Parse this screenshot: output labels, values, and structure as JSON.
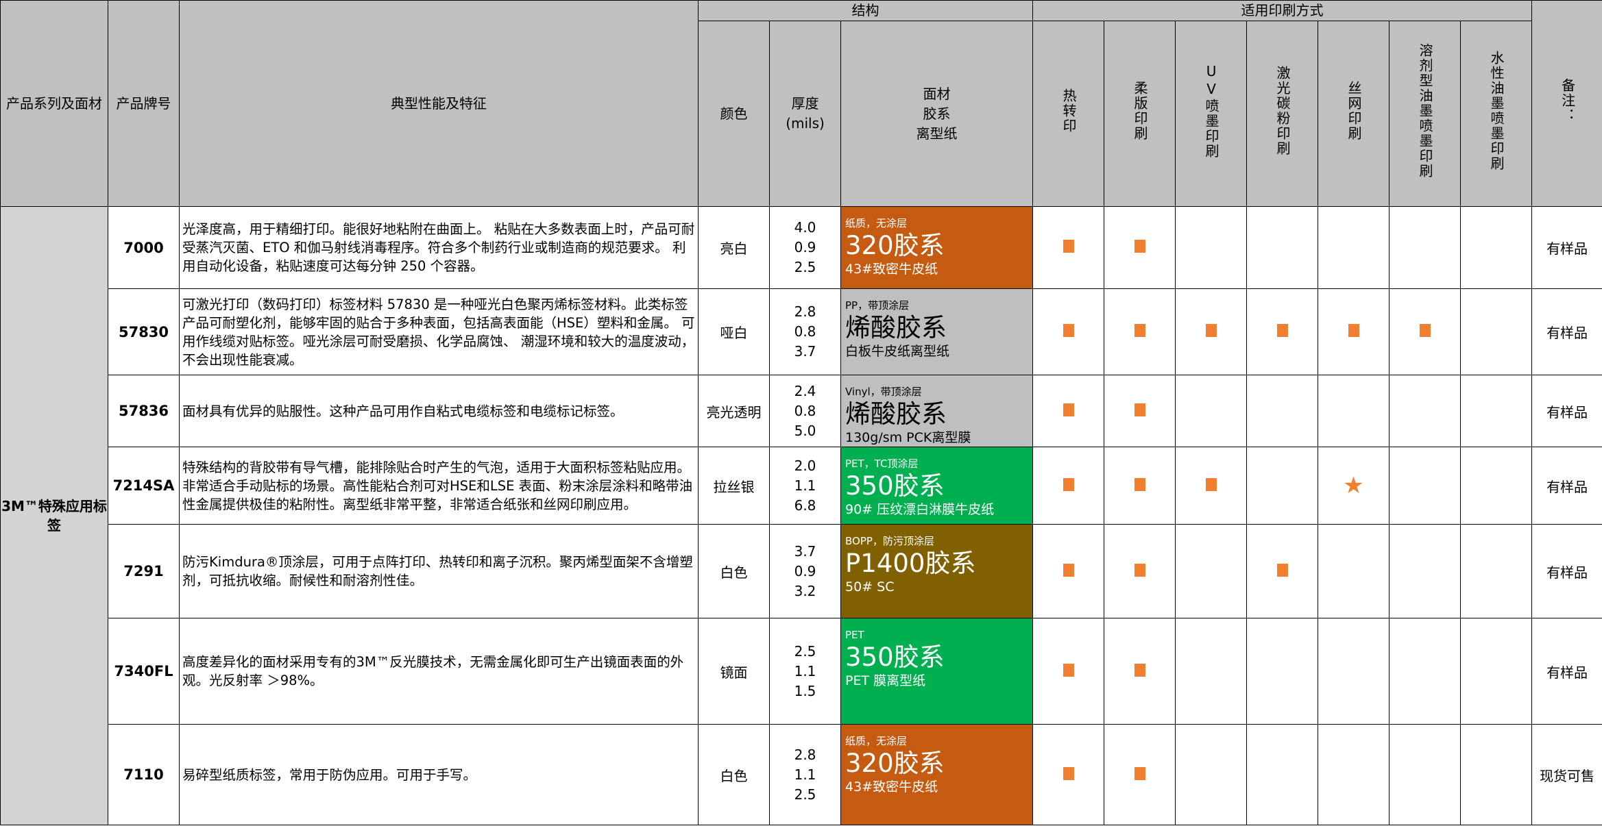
{
  "headers": {
    "series": "产品系列及面材",
    "pn": "产品牌号",
    "desc": "典型性能及特征",
    "structure_group": "结构",
    "print_group": "适用印刷方式",
    "color": "颜色",
    "thickness": "厚度\n(mils)",
    "material": "面材\n胶系\n离型纸",
    "thermal": "热转印",
    "flexo": "柔版印刷",
    "uv": "UV喷墨印刷",
    "laser": "激光碳粉印刷",
    "screen": "丝网印刷",
    "solvent": "溶剂型油墨喷墨印刷",
    "water": "水性油墨喷墨印刷",
    "notes": "备注："
  },
  "series_name": "3M™特殊应用标签",
  "mark_color": "#f08030",
  "rows": [
    {
      "pn": "7000",
      "desc": "光泽度高，用于精细打印。能很好地粘附在曲面上。 粘贴在大多数表面上时，产品可耐受蒸汽灭菌、ETO 和伽马射线消毒程序。符合多个制药行业或制造商的规范要求。 利用自动化设备，粘贴速度可达每分钟 250 个容器。",
      "color": "亮白",
      "thickness": [
        "4.0",
        "0.9",
        "2.5"
      ],
      "face": "纸质，无涂层",
      "adhesive": "320胶系",
      "liner": "43#致密牛皮纸",
      "struct_color": "orange",
      "marks": [
        "sq",
        "sq",
        "",
        "",
        "",
        "",
        ""
      ],
      "note": "有样品"
    },
    {
      "pn": "57830",
      "desc": "可激光打印（数码打印）标签材料 57830 是一种哑光白色聚丙烯标签材料。此类标签产品可耐塑化剂，能够牢固的贴合于多种表面，包括高表面能（HSE）塑料和金属。 可用作线缆对贴标签。哑光涂层可耐受磨损、化学品腐蚀、 潮湿环境和较大的温度波动，不会出现性能衰减。",
      "color": "哑白",
      "thickness": [
        "2.8",
        "0.8",
        "3.7"
      ],
      "face": "PP，带顶涂层",
      "adhesive": "烯酸胶系",
      "liner": "白板牛皮纸离型纸",
      "struct_color": "gray",
      "marks": [
        "sq",
        "sq",
        "sq",
        "sq",
        "sq",
        "sq",
        ""
      ],
      "note": "有样品"
    },
    {
      "pn": "57836",
      "desc": "面材具有优异的贴服性。这种产品可用作自粘式电缆标签和电缆标记标签。",
      "color": "亮光透明",
      "thickness": [
        "2.4",
        "0.8",
        "5.0"
      ],
      "face": "Vinyl，带顶涂层",
      "adhesive": "烯酸胶系",
      "liner": "130g/sm PCK离型膜",
      "struct_color": "gray",
      "marks": [
        "sq",
        "sq",
        "",
        "",
        "",
        "",
        ""
      ],
      "note": "有样品"
    },
    {
      "pn": "7214SA",
      "desc": "特殊结构的背胶带有导气槽，能排除贴合时产生的气泡，适用于大面积标签粘贴应用。非常适合手动贴标的场景。高性能粘合剂可对HSE和LSE 表面、粉末涂层涂料和略带油性金属提供极佳的粘附性。离型纸非常平整，非常适合纸张和丝网印刷应用。",
      "color": "拉丝银",
      "thickness": [
        "2.0",
        "1.1",
        "6.8"
      ],
      "face": "PET，TC顶涂层",
      "adhesive": "350胶系",
      "liner": "90# 压纹漂白淋膜牛皮纸",
      "struct_color": "green",
      "marks": [
        "sq",
        "sq",
        "sq",
        "",
        "star",
        "",
        ""
      ],
      "star_symbol": "★",
      "note": "有样品"
    },
    {
      "pn": "7291",
      "desc": "防污Kimdura®顶涂层，可用于点阵打印、热转印和离子沉积。聚丙烯型面架不含增塑剂，可抵抗收缩。耐候性和耐溶剂性佳。",
      "color": "白色",
      "thickness": [
        "3.7",
        "0.9",
        "3.2"
      ],
      "face": "BOPP，防污顶涂层",
      "adhesive": "P1400胶系",
      "liner": "50# SC",
      "struct_color": "olive",
      "marks": [
        "sq",
        "sq",
        "",
        "sq",
        "",
        "",
        ""
      ],
      "note": "有样品"
    },
    {
      "pn": "7340FL",
      "desc": "高度差异化的面材采用专有的3M™反光膜技术，无需金属化即可生产出镜面表面的外观。光反射率 ＞98%。",
      "color": "镜面",
      "thickness": [
        "2.5",
        "1.1",
        "1.5"
      ],
      "face": "PET",
      "adhesive": "350胶系",
      "liner": "PET 膜离型纸",
      "struct_color": "green",
      "marks": [
        "sq",
        "sq",
        "",
        "",
        "",
        "",
        ""
      ],
      "note": "有样品"
    },
    {
      "pn": "7110",
      "desc": "易碎型纸质标签，常用于防伪应用。可用于手写。",
      "color": "白色",
      "thickness": [
        "2.8",
        "1.1",
        "2.5"
      ],
      "face": "纸质，无涂层",
      "adhesive": "320胶系",
      "liner": "43#致密牛皮纸",
      "struct_color": "orange",
      "marks": [
        "sq",
        "sq",
        "",
        "",
        "",
        "",
        ""
      ],
      "note": "现货可售"
    }
  ]
}
